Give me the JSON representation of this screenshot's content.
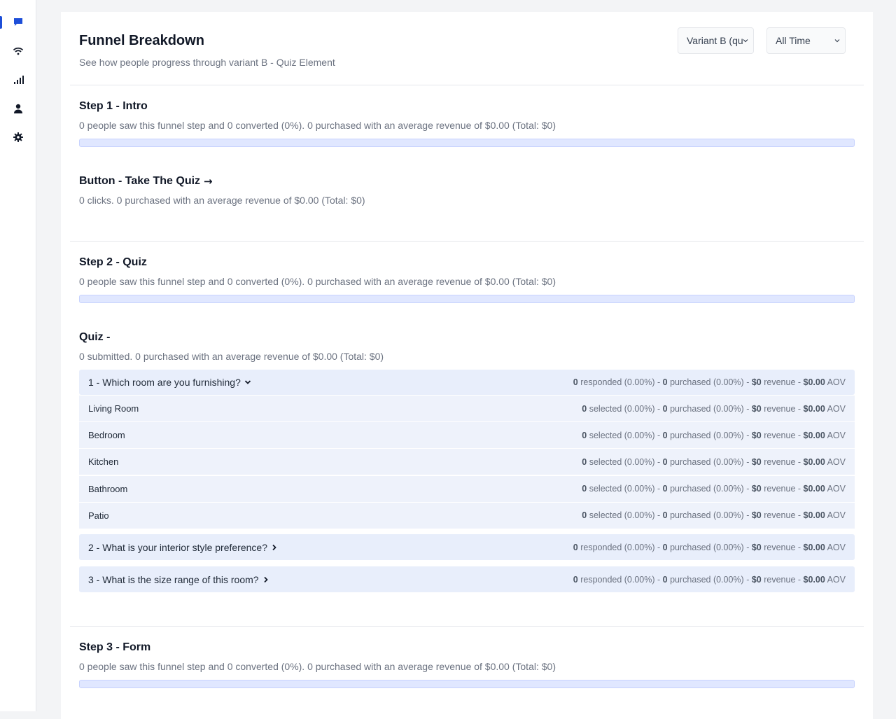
{
  "nav": [
    {
      "icon": "chat-icon",
      "active": true
    },
    {
      "icon": "wifi-icon",
      "active": false
    },
    {
      "icon": "bar-chart-icon",
      "active": false
    },
    {
      "icon": "user-icon",
      "active": false
    },
    {
      "icon": "gear-icon",
      "active": false
    }
  ],
  "header": {
    "title": "Funnel Breakdown",
    "subtitle": "See how people progress through variant B - Quiz Element",
    "variant_select": "Variant B (qu",
    "time_select": "All Time"
  },
  "steps": {
    "intro": {
      "title": "Step 1 - Intro",
      "desc": "0 people saw this funnel step and 0 converted (0%). 0 purchased with an average revenue of $0.00 (Total: $0)",
      "progress": 0
    },
    "button": {
      "title": "Button - Take The Quiz",
      "arrow": "→",
      "desc": "0 clicks. 0 purchased with an average revenue of $0.00 (Total: $0)"
    },
    "quiz_step": {
      "title": "Step 2 - Quiz",
      "desc": "0 people saw this funnel step and 0 converted (0%). 0 purchased with an average revenue of $0.00 (Total: $0)",
      "progress": 0
    },
    "quiz": {
      "title": "Quiz -",
      "desc": "0 submitted. 0 purchased with an average revenue of $0.00 (Total: $0)",
      "q1": {
        "label": "1 - Which room are you furnishing?",
        "responded": "0",
        "responded_pct": "responded (0.00%)",
        "purchased": "0",
        "purchased_pct": "purchased (0.00%)",
        "revenue": "$0",
        "revenue_label": "revenue",
        "aov": "$0.00",
        "aov_label": "AOV",
        "options": [
          {
            "label": "Living Room",
            "selected": "0",
            "selected_pct": "selected (0.00%)",
            "purchased": "0",
            "purchased_pct": "purchased (0.00%)",
            "revenue": "$0",
            "revenue_label": "revenue",
            "aov": "$0.00",
            "aov_label": "AOV"
          },
          {
            "label": "Bedroom",
            "selected": "0",
            "selected_pct": "selected (0.00%)",
            "purchased": "0",
            "purchased_pct": "purchased (0.00%)",
            "revenue": "$0",
            "revenue_label": "revenue",
            "aov": "$0.00",
            "aov_label": "AOV"
          },
          {
            "label": "Kitchen",
            "selected": "0",
            "selected_pct": "selected (0.00%)",
            "purchased": "0",
            "purchased_pct": "purchased (0.00%)",
            "revenue": "$0",
            "revenue_label": "revenue",
            "aov": "$0.00",
            "aov_label": "AOV"
          },
          {
            "label": "Bathroom",
            "selected": "0",
            "selected_pct": "selected (0.00%)",
            "purchased": "0",
            "purchased_pct": "purchased (0.00%)",
            "revenue": "$0",
            "revenue_label": "revenue",
            "aov": "$0.00",
            "aov_label": "AOV"
          },
          {
            "label": "Patio",
            "selected": "0",
            "selected_pct": "selected (0.00%)",
            "purchased": "0",
            "purchased_pct": "purchased (0.00%)",
            "revenue": "$0",
            "revenue_label": "revenue",
            "aov": "$0.00",
            "aov_label": "AOV"
          }
        ]
      },
      "q2": {
        "label": "2 - What is your interior style preference?",
        "responded": "0",
        "responded_pct": "responded (0.00%)",
        "purchased": "0",
        "purchased_pct": "purchased (0.00%)",
        "revenue": "$0",
        "revenue_label": "revenue",
        "aov": "$0.00",
        "aov_label": "AOV"
      },
      "q3": {
        "label": "3 - What is the size range of this room?",
        "responded": "0",
        "responded_pct": "responded (0.00%)",
        "purchased": "0",
        "purchased_pct": "purchased (0.00%)",
        "revenue": "$0",
        "revenue_label": "revenue",
        "aov": "$0.00",
        "aov_label": "AOV"
      }
    },
    "form": {
      "title": "Step 3 - Form",
      "desc": "0 people saw this funnel step and 0 converted (0%). 0 purchased with an average revenue of $0.00 (Total: $0)",
      "progress": 0
    }
  },
  "separator": " - ",
  "colors": {
    "accent": "#1d4ed8",
    "bar_bg": "#e0e7ff",
    "row_bg": "#e8eefb"
  }
}
